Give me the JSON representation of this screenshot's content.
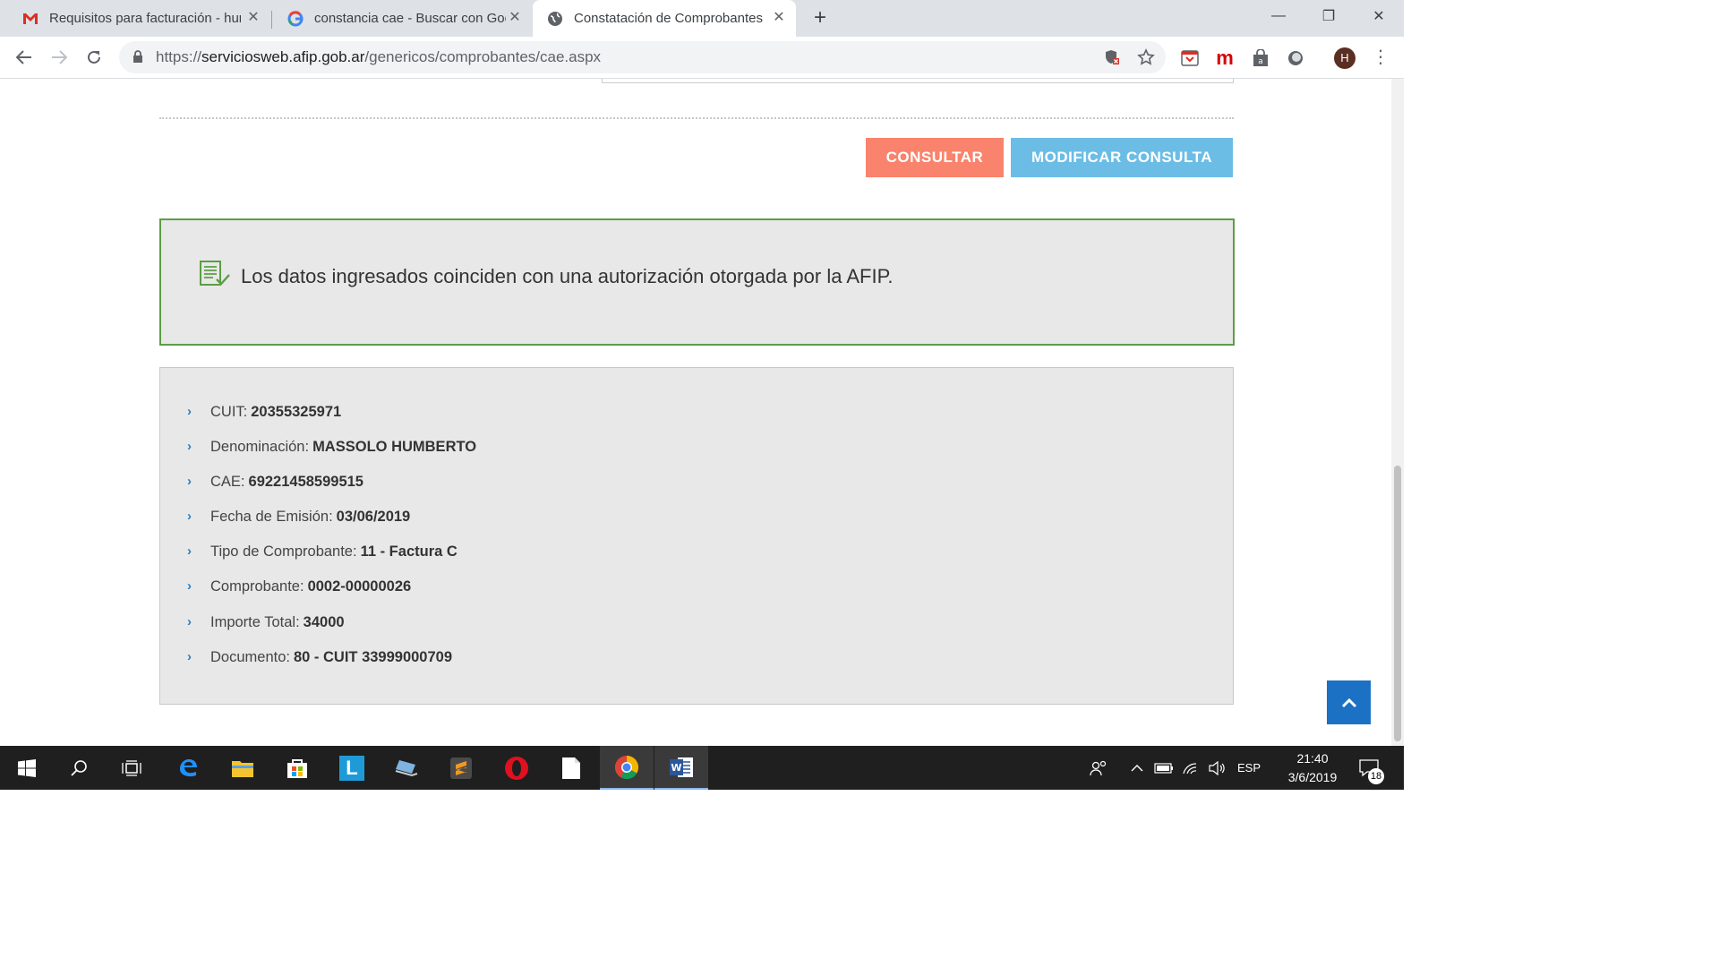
{
  "browser": {
    "tabs": [
      {
        "title": "Requisitos para facturación - hum",
        "favicon": "gmail-icon",
        "active": false
      },
      {
        "title": "constancia cae - Buscar con Goo",
        "favicon": "google-icon",
        "active": false
      },
      {
        "title": "Constatación de Comprobantes |",
        "favicon": "globe-icon",
        "active": true
      }
    ],
    "url_scheme": "https://",
    "url_host": "serviciosweb.afip.gob.ar",
    "url_path": "/genericos/comprobantes/cae.aspx",
    "profile_initial": "H"
  },
  "page": {
    "buttons": {
      "consultar": "CONSULTAR",
      "modificar": "MODIFICAR CONSULTA"
    },
    "result_message": "Los datos ingresados coinciden con una autorización otorgada por la AFIP.",
    "details": [
      {
        "label": "CUIT:",
        "value": "20355325971"
      },
      {
        "label": "Denominación:",
        "value": "MASSOLO HUMBERTO"
      },
      {
        "label": "CAE:",
        "value": "69221458599515"
      },
      {
        "label": "Fecha de Emisión:",
        "value": "03/06/2019"
      },
      {
        "label": "Tipo de Comprobante:",
        "value": "11 - Factura C"
      },
      {
        "label": "Comprobante:",
        "value": "0002-00000026"
      },
      {
        "label": "Importe Total:",
        "value": "34000"
      },
      {
        "label": "Documento:",
        "value": "80 - CUIT 33999000709"
      }
    ]
  },
  "taskbar": {
    "language": "ESP",
    "time": "21:40",
    "date": "3/6/2019",
    "notification_count": "18"
  },
  "colors": {
    "consultar": "#f9836c",
    "modificar": "#6cbde6",
    "success_border": "#5c9e45",
    "to_top": "#1b71c4"
  }
}
